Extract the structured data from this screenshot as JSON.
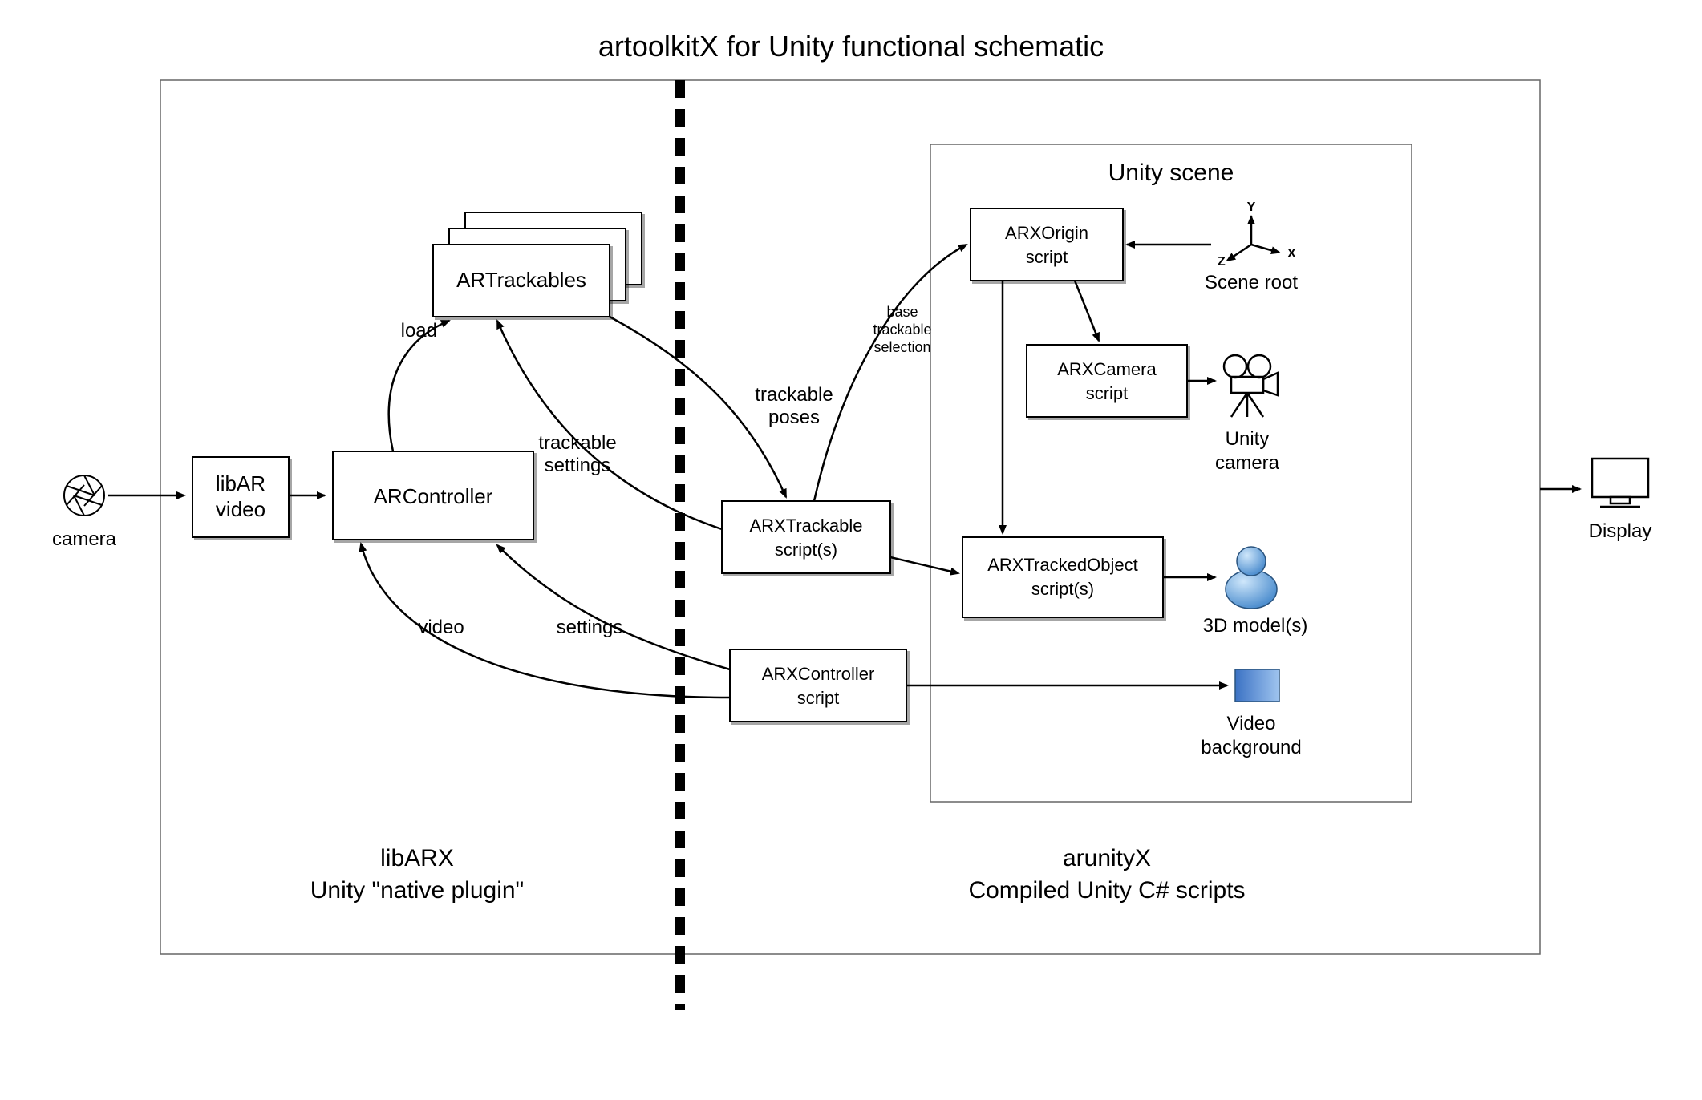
{
  "title": "artoolkitX for Unity functional schematic",
  "external": {
    "camera": "camera",
    "display": "Display"
  },
  "left": {
    "region_line1": "libARX",
    "region_line2": "Unity \"native plugin\"",
    "libarvideo_l1": "libAR",
    "libarvideo_l2": "video",
    "arcontroller": "ARController",
    "artrackables": "ARTrackables",
    "lbl_load": "load",
    "lbl_trackable_settings_l1": "trackable",
    "lbl_trackable_settings_l2": "settings",
    "lbl_trackable_poses_l1": "trackable",
    "lbl_trackable_poses_l2": "poses",
    "lbl_video": "video",
    "lbl_settings": "settings"
  },
  "right": {
    "region_line1": "arunityX",
    "region_line2": "Compiled Unity C# scripts",
    "scene_title": "Unity scene",
    "arxtrackable_l1": "ARXTrackable",
    "arxtrackable_l2": "script(s)",
    "arxcontroller_l1": "ARXController",
    "arxcontroller_l2": "script",
    "arxorigin_l1": "ARXOrigin",
    "arxorigin_l2": "script",
    "arxcamera_l1": "ARXCamera",
    "arxcamera_l2": "script",
    "arxtracked_l1": "ARXTrackedObject",
    "arxtracked_l2": "script(s)",
    "lbl_base_l1": "base",
    "lbl_base_l2": "trackable",
    "lbl_base_l3": "selection",
    "scene_root": "Scene root",
    "unity_camera_l1": "Unity",
    "unity_camera_l2": "camera",
    "model3d": "3D model(s)",
    "video_bg_l1": "Video",
    "video_bg_l2": "background"
  }
}
